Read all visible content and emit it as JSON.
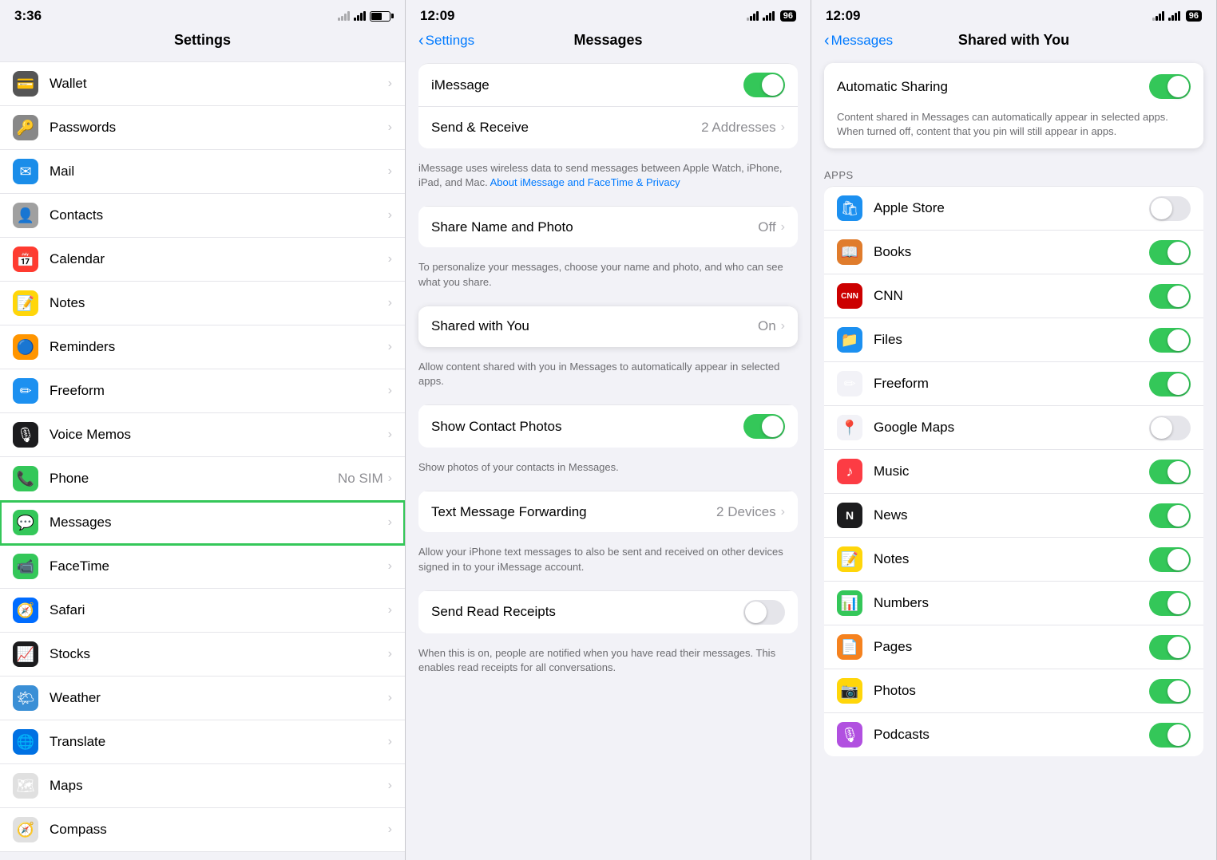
{
  "panel1": {
    "status": {
      "time": "3:36"
    },
    "header": {
      "title": "Settings"
    },
    "items": [
      {
        "id": "wallet",
        "icon": "ic-wallet",
        "iconText": "💳",
        "label": "Wallet",
        "value": "",
        "chevron": true
      },
      {
        "id": "passwords",
        "icon": "ic-passwords",
        "iconText": "🔑",
        "label": "Passwords",
        "value": "",
        "chevron": true
      },
      {
        "id": "mail",
        "icon": "ic-mail",
        "iconText": "✉",
        "label": "Mail",
        "value": "",
        "chevron": true
      },
      {
        "id": "contacts",
        "icon": "ic-contacts",
        "iconText": "👤",
        "label": "Contacts",
        "value": "",
        "chevron": true
      },
      {
        "id": "calendar",
        "icon": "ic-calendar",
        "iconText": "📅",
        "label": "Calendar",
        "value": "",
        "chevron": true
      },
      {
        "id": "notes",
        "icon": "ic-notes",
        "iconText": "📝",
        "label": "Notes",
        "value": "",
        "chevron": true
      },
      {
        "id": "reminders",
        "icon": "ic-reminders",
        "iconText": "🔵",
        "label": "Reminders",
        "value": "",
        "chevron": true
      },
      {
        "id": "freeform",
        "icon": "ic-freeform",
        "iconText": "🖊",
        "label": "Freeform",
        "value": "",
        "chevron": true
      },
      {
        "id": "voicememos",
        "icon": "ic-voicememos",
        "iconText": "🎙",
        "label": "Voice Memos",
        "value": "",
        "chevron": true
      },
      {
        "id": "phone",
        "icon": "ic-phone",
        "iconText": "📞",
        "label": "Phone",
        "value": "No SIM",
        "chevron": true
      },
      {
        "id": "messages",
        "icon": "ic-messages",
        "iconText": "💬",
        "label": "Messages",
        "value": "",
        "chevron": true,
        "selected": true
      },
      {
        "id": "facetime",
        "icon": "ic-facetime",
        "iconText": "📹",
        "label": "FaceTime",
        "value": "",
        "chevron": true
      },
      {
        "id": "safari",
        "icon": "ic-safari",
        "iconText": "🧭",
        "label": "Safari",
        "value": "",
        "chevron": true
      },
      {
        "id": "stocks",
        "icon": "ic-stocks",
        "iconText": "📈",
        "label": "Stocks",
        "value": "",
        "chevron": true
      },
      {
        "id": "weather",
        "icon": "ic-weather",
        "iconText": "🌤",
        "label": "Weather",
        "value": "",
        "chevron": true
      },
      {
        "id": "translate",
        "icon": "ic-translate",
        "iconText": "🌐",
        "label": "Translate",
        "value": "",
        "chevron": true
      },
      {
        "id": "maps",
        "icon": "ic-maps",
        "iconText": "🗺",
        "label": "Maps",
        "value": "",
        "chevron": true
      },
      {
        "id": "compass",
        "icon": "ic-compass",
        "iconText": "🧭",
        "label": "Compass",
        "value": "",
        "chevron": true
      }
    ]
  },
  "panel2": {
    "status": {
      "time": "12:09",
      "battery": "96"
    },
    "header": {
      "back": "Settings",
      "title": "Messages"
    },
    "sections": {
      "imessage": {
        "label": "iMessage",
        "toggleOn": true
      },
      "sendReceive": {
        "label": "Send & Receive",
        "value": "2 Addresses"
      },
      "imessageDesc": "iMessage uses wireless data to send messages between Apple Watch, iPhone, iPad, and Mac.",
      "imessageLinkText": "About iMessage and FaceTime & Privacy",
      "shareNamePhoto": {
        "label": "Share Name and Photo",
        "value": "Off"
      },
      "shareDesc": "To personalize your messages, choose your name and photo, and who can see what you share.",
      "sharedWithYou": {
        "label": "Shared with You",
        "value": "On"
      },
      "sharedDesc": "Allow content shared with you in Messages to automatically appear in selected apps.",
      "showContactPhotos": {
        "label": "Show Contact Photos",
        "toggleOn": true
      },
      "showContactDesc": "Show photos of your contacts in Messages.",
      "textMessageFwd": {
        "label": "Text Message Forwarding",
        "value": "2 Devices"
      },
      "textMsgDesc": "Allow your iPhone text messages to also be sent and received on other devices signed in to your iMessage account.",
      "sendReadReceipts": {
        "label": "Send Read Receipts",
        "toggleOn": false
      },
      "sendReadDesc": "When this is on, people are notified when you have read their messages. This enables read receipts for all conversations."
    }
  },
  "panel3": {
    "status": {
      "time": "12:09",
      "battery": "96"
    },
    "header": {
      "back": "Messages",
      "title": "Shared with You"
    },
    "autoSharing": {
      "label": "Automatic Sharing",
      "toggleOn": true,
      "desc": "Content shared in Messages can automatically appear in selected apps. When turned off, content that you pin will still appear in apps."
    },
    "appsLabel": "APPS",
    "apps": [
      {
        "id": "applestore",
        "icon": "ic-applestore",
        "iconText": "🛍",
        "label": "Apple Store",
        "toggleOn": false
      },
      {
        "id": "books",
        "icon": "ic-books",
        "iconText": "📖",
        "label": "Books",
        "toggleOn": true
      },
      {
        "id": "cnn",
        "icon": "ic-cnn",
        "iconText": "C",
        "label": "CNN",
        "toggleOn": true
      },
      {
        "id": "files",
        "icon": "ic-files",
        "iconText": "📁",
        "label": "Files",
        "toggleOn": true
      },
      {
        "id": "freeform",
        "icon": "ic-freeform2",
        "iconText": "✏",
        "label": "Freeform",
        "toggleOn": true
      },
      {
        "id": "googlemaps",
        "icon": "ic-googlemaps",
        "iconText": "📍",
        "label": "Google Maps",
        "toggleOn": false
      },
      {
        "id": "music",
        "icon": "ic-music",
        "iconText": "♪",
        "label": "Music",
        "toggleOn": true
      },
      {
        "id": "news",
        "icon": "ic-news",
        "iconText": "N",
        "label": "News",
        "toggleOn": true
      },
      {
        "id": "notes",
        "icon": "ic-notes2",
        "iconText": "📝",
        "label": "Notes",
        "toggleOn": true
      },
      {
        "id": "numbers",
        "icon": "ic-numbers",
        "iconText": "📊",
        "label": "Numbers",
        "toggleOn": true
      },
      {
        "id": "pages",
        "icon": "ic-pages",
        "iconText": "📄",
        "label": "Pages",
        "toggleOn": true
      },
      {
        "id": "photos",
        "icon": "ic-photos",
        "iconText": "🖼",
        "label": "Photos",
        "toggleOn": true
      },
      {
        "id": "podcasts",
        "icon": "ic-podcast",
        "iconText": "🎙",
        "label": "Podcasts",
        "toggleOn": true
      }
    ]
  }
}
